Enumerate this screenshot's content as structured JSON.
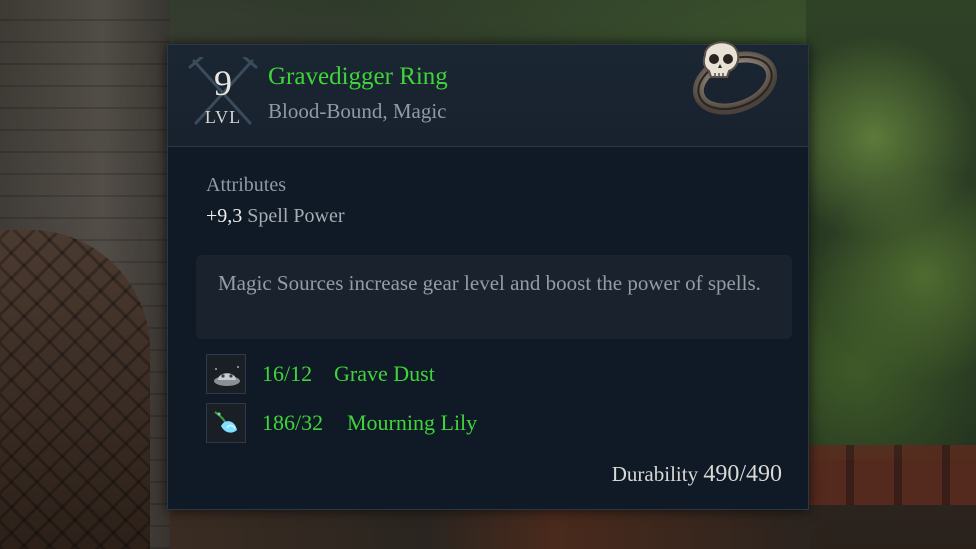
{
  "item": {
    "level": "9",
    "level_label": "LVL",
    "name": "Gravedigger Ring",
    "type": "Blood-Bound, Magic",
    "icon": "skull-ring-icon"
  },
  "attributes": {
    "heading": "Attributes",
    "lines": [
      {
        "value": "+9,3",
        "name": "Spell Power"
      }
    ]
  },
  "info_text": "Magic Sources increase gear level and boost the power of spells.",
  "magic_sources": [
    {
      "count": "16/12",
      "name": "Grave Dust",
      "icon": "grave-dust-icon"
    },
    {
      "count": "186/32",
      "name": "Mourning Lily",
      "icon": "mourning-lily-icon"
    }
  ],
  "durability": {
    "label": "Durability",
    "value": "490/490"
  },
  "colors": {
    "name_green": "#3fd43a",
    "panel_bg": "#101a26",
    "muted_text": "#8f9aa5"
  }
}
